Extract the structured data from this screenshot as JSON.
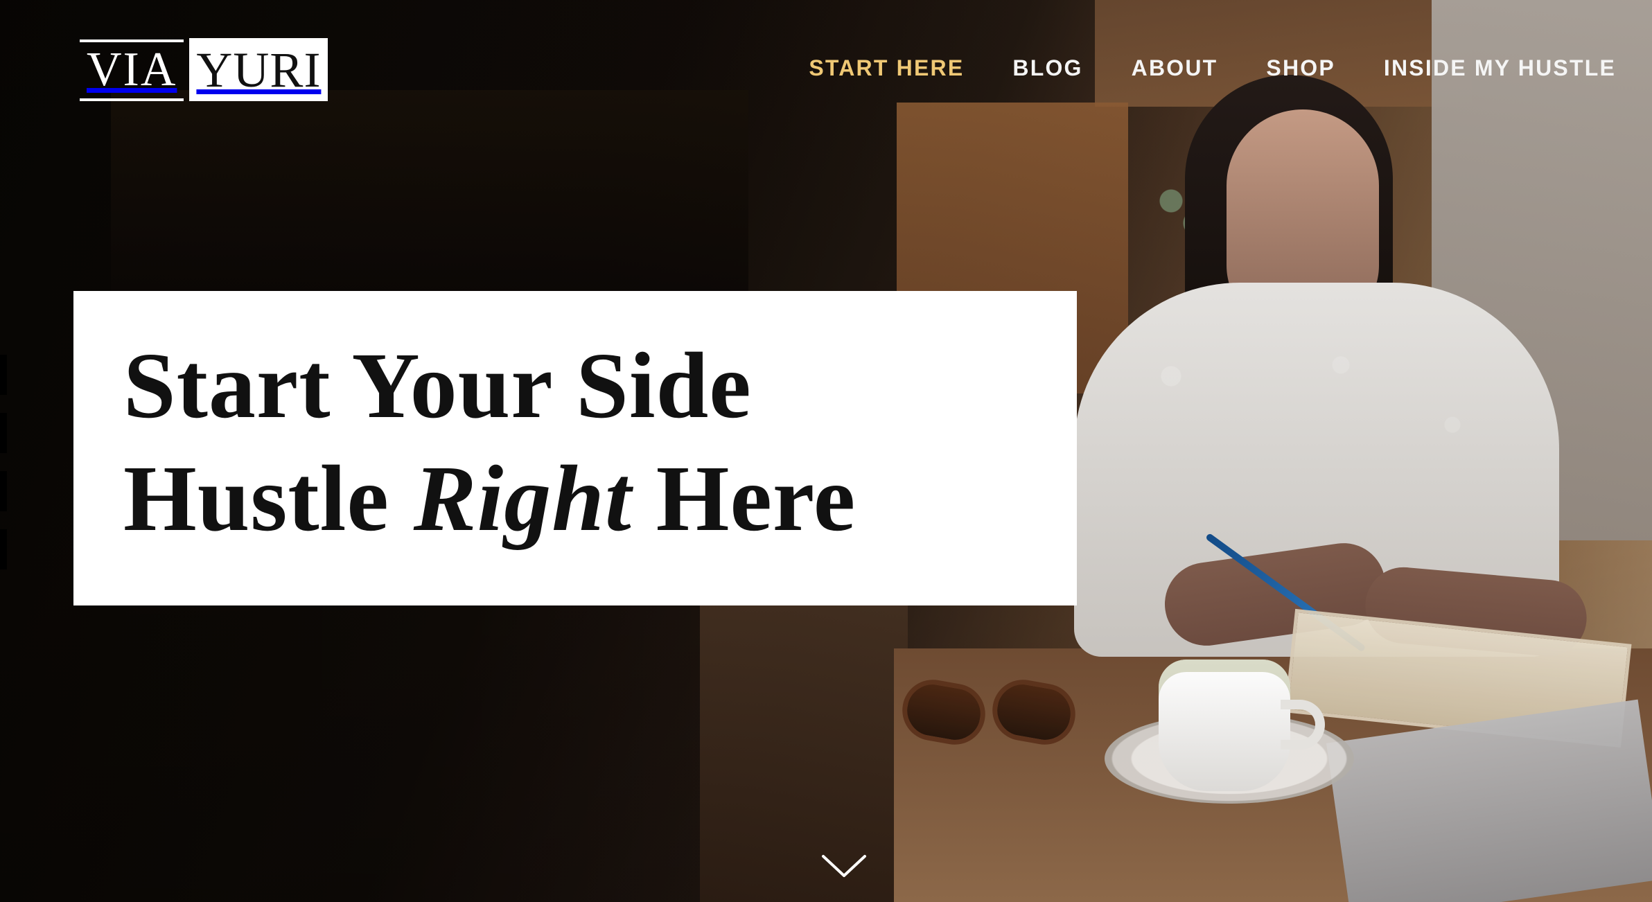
{
  "brand": {
    "logo_left": "VIA",
    "logo_right": "YURI"
  },
  "navigation": {
    "items": [
      {
        "label": "START HERE",
        "active": true
      },
      {
        "label": "BLOG",
        "active": false
      },
      {
        "label": "ABOUT",
        "active": false
      },
      {
        "label": "SHOP",
        "active": false
      },
      {
        "label": "INSIDE MY HUSTLE",
        "active": false
      }
    ],
    "active_color": "#efc875",
    "text_color": "#f5f5f5"
  },
  "hero": {
    "line1": "Start Your Side",
    "line2_before": "Hustle ",
    "line2_emphasis": "Right",
    "line2_after": " Here"
  },
  "icons": {
    "scroll": "chevron-down-icon"
  },
  "colors": {
    "card_background": "#ffffff",
    "headline_text": "#111111",
    "background_dark": "#0b0806"
  }
}
